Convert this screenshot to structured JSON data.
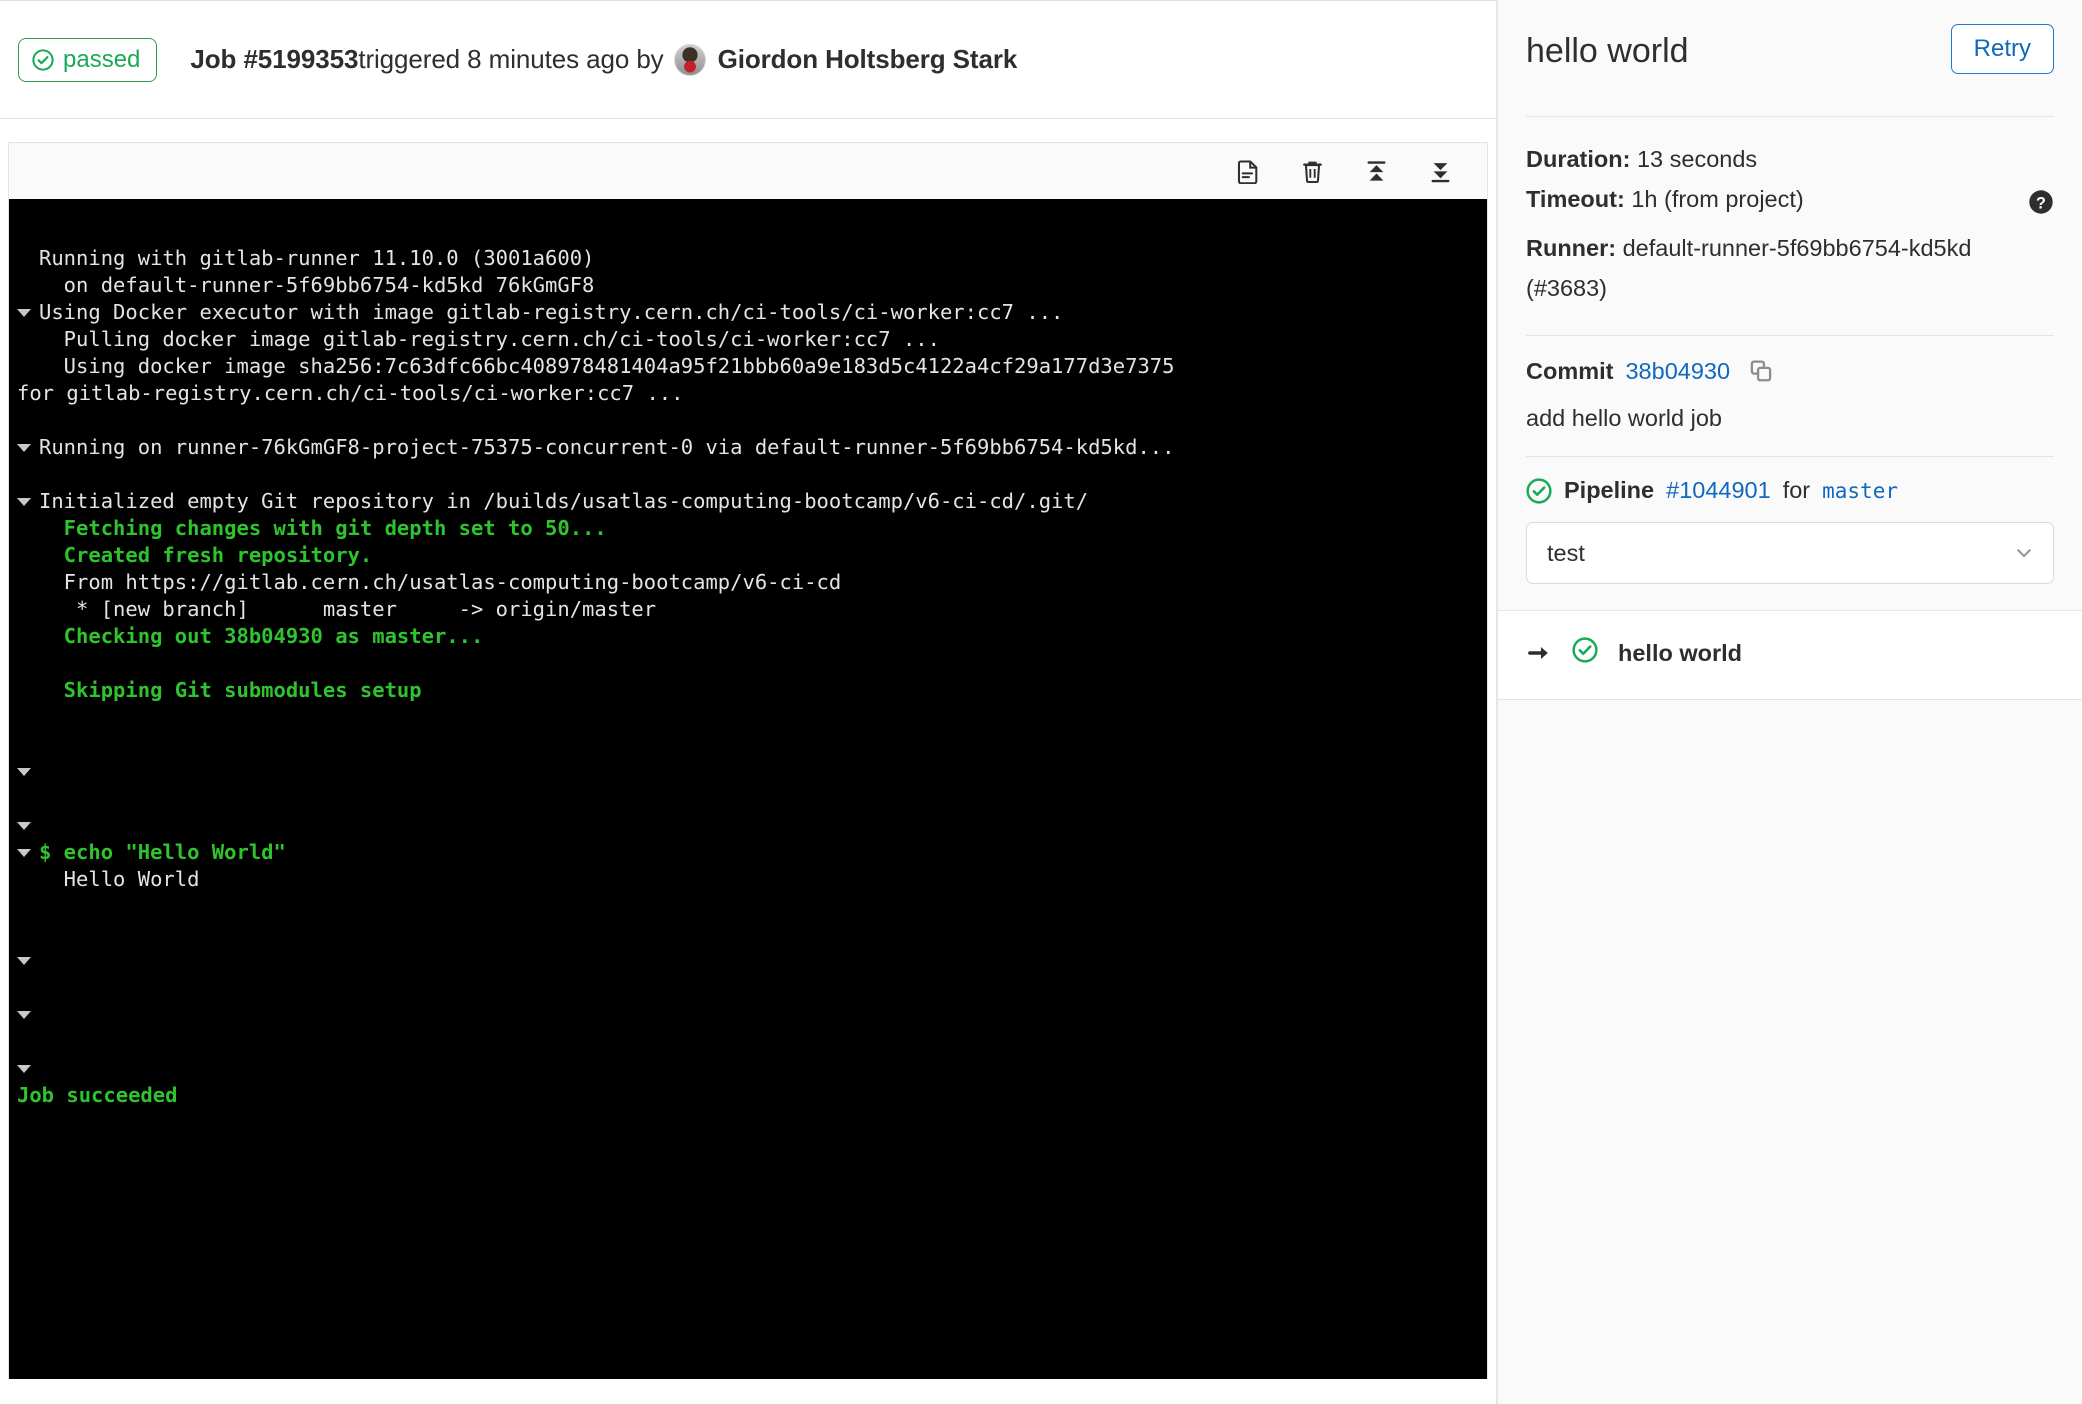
{
  "header": {
    "status_badge": "passed",
    "status_icon": "status-success-icon",
    "job_label": "Job #5199353",
    "triggered_text": " triggered 8 minutes ago by ",
    "author": "Giordon Holtsberg Stark"
  },
  "toolbar": {
    "buttons": [
      {
        "name": "raw-log-button",
        "icon": "file-text-icon"
      },
      {
        "name": "erase-log-button",
        "icon": "trash-icon"
      },
      {
        "name": "scroll-to-top-button",
        "icon": "scroll-up-icon"
      },
      {
        "name": "scroll-to-bottom-button",
        "icon": "scroll-down-icon"
      }
    ]
  },
  "terminal": {
    "lines": [
      {
        "text": "Running with gitlab-runner 11.10.0 (3001a600)",
        "color": "w",
        "arrow": false
      },
      {
        "text": "  on default-runner-5f69bb6754-kd5kd 76kGmGF8",
        "color": "w",
        "arrow": false
      },
      {
        "text": "Using Docker executor with image gitlab-registry.cern.ch/ci-tools/ci-worker:cc7 ...",
        "color": "w",
        "arrow": true
      },
      {
        "text": "  Pulling docker image gitlab-registry.cern.ch/ci-tools/ci-worker:cc7 ...",
        "color": "w",
        "arrow": false
      },
      {
        "text": "  Using docker image sha256:7c63dfc66bc408978481404a95f21bbb60a9e183d5c4122a4cf29a177d3e7375",
        "color": "w",
        "arrow": false
      },
      {
        "text": "for gitlab-registry.cern.ch/ci-tools/ci-worker:cc7 ...",
        "color": "w",
        "arrow": false,
        "nopad": true
      },
      {
        "text": "",
        "color": "w",
        "arrow": false
      },
      {
        "text": "Running on runner-76kGmGF8-project-75375-concurrent-0 via default-runner-5f69bb6754-kd5kd...",
        "color": "w",
        "arrow": true
      },
      {
        "text": "",
        "color": "w",
        "arrow": false
      },
      {
        "text": "Initialized empty Git repository in /builds/usatlas-computing-bootcamp/v6-ci-cd/.git/",
        "color": "w",
        "arrow": true
      },
      {
        "text": "  Fetching changes with git depth set to 50...",
        "color": "g",
        "arrow": false
      },
      {
        "text": "  Created fresh repository.",
        "color": "g",
        "arrow": false
      },
      {
        "text": "  From https://gitlab.cern.ch/usatlas-computing-bootcamp/v6-ci-cd",
        "color": "w",
        "arrow": false
      },
      {
        "text": "   * [new branch]      master     -> origin/master",
        "color": "w",
        "arrow": false
      },
      {
        "text": "  Checking out 38b04930 as master...",
        "color": "g",
        "arrow": false
      },
      {
        "text": "",
        "color": "w",
        "arrow": false
      },
      {
        "text": "  Skipping Git submodules setup",
        "color": "g",
        "arrow": false
      },
      {
        "text": "",
        "color": "w",
        "arrow": false
      },
      {
        "text": "",
        "color": "w",
        "arrow": false
      },
      {
        "text": "",
        "color": "w",
        "arrow": true
      },
      {
        "text": "",
        "color": "w",
        "arrow": false
      },
      {
        "text": "",
        "color": "w",
        "arrow": true
      },
      {
        "text": "$ echo \"Hello World\"",
        "color": "g",
        "arrow": true
      },
      {
        "text": "  Hello World",
        "color": "w",
        "arrow": false
      },
      {
        "text": "",
        "color": "w",
        "arrow": false
      },
      {
        "text": "",
        "color": "w",
        "arrow": false
      },
      {
        "text": "",
        "color": "w",
        "arrow": true
      },
      {
        "text": "",
        "color": "w",
        "arrow": false
      },
      {
        "text": "",
        "color": "w",
        "arrow": true
      },
      {
        "text": "",
        "color": "w",
        "arrow": false
      },
      {
        "text": "",
        "color": "w",
        "arrow": true
      },
      {
        "text": "Job succeeded",
        "color": "g",
        "arrow": false,
        "nopad": true
      }
    ]
  },
  "sidebar": {
    "title": "hello world",
    "retry_label": "Retry",
    "meta": {
      "duration_label": "Duration:",
      "duration_value": " 13 seconds",
      "timeout_label": "Timeout:",
      "timeout_value": " 1h (from project)",
      "timeout_help_icon": "question-circle-icon",
      "runner_label": "Runner:",
      "runner_value": " default-runner-5f69bb6754-kd5kd (#3683)"
    },
    "commit": {
      "label": "Commit",
      "sha": "38b04930",
      "copy_icon": "copy-icon",
      "message": "add hello world job"
    },
    "pipeline": {
      "status_icon": "status-success-icon",
      "label": "Pipeline",
      "id": "#1044901",
      "for_text": "for",
      "branch": "master",
      "stage_selected": "test",
      "stage_chevron_icon": "chevron-down-icon"
    },
    "jobs": [
      {
        "arrow_icon": "arrow-right-icon",
        "status_icon": "status-success-icon",
        "label": "hello world"
      }
    ]
  },
  "colors": {
    "success_green": "#1aaa55",
    "terminal_green": "#2fc42f",
    "link_blue": "#1068bf",
    "border": "#e5e5e5"
  }
}
